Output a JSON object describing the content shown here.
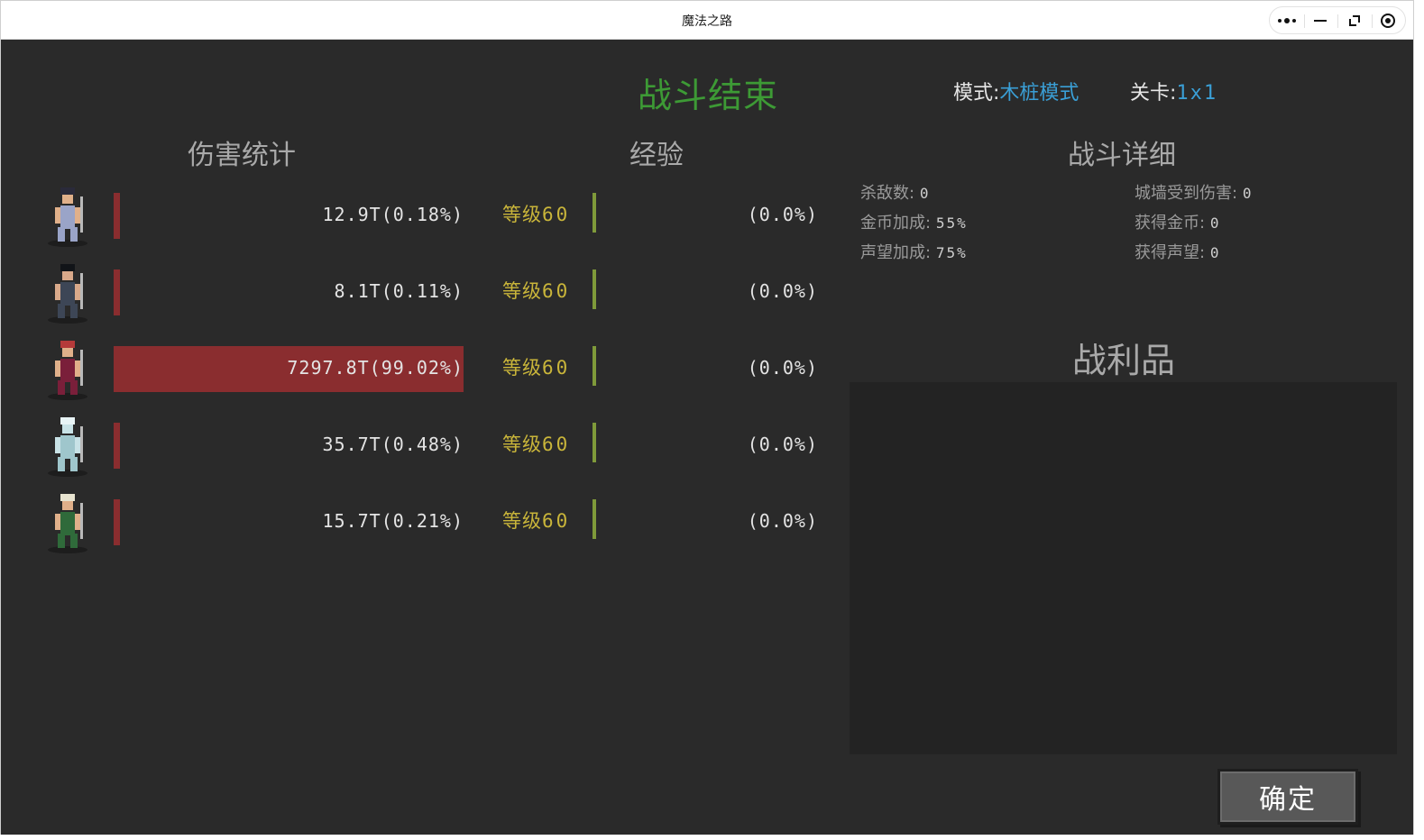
{
  "window": {
    "title": "魔法之路"
  },
  "titlebar": {
    "more_icon": "more-dots-icon",
    "minimize_icon": "minimize-icon",
    "restore_icon": "restore-icon",
    "record_icon": "target-icon"
  },
  "header": {
    "title": "战斗结束",
    "mode_label": "模式:",
    "mode_value": "木桩模式",
    "stage_label": "关卡:",
    "stage_value": "1x1"
  },
  "columns": {
    "damage": "伤害统计",
    "exp": "经验",
    "detail": "战斗详细"
  },
  "heroes": [
    {
      "damage": "12.9T(0.18%)",
      "damage_fraction": 0.0018,
      "level_label": "等级",
      "level": "60",
      "exp": "(0.0%)",
      "exp_fraction": 0.0,
      "colors": {
        "skin": "#e0b08a",
        "cloth": "#9aa4c8",
        "hair": "#2a2a3a"
      }
    },
    {
      "damage": "8.1T(0.11%)",
      "damage_fraction": 0.0011,
      "level_label": "等级",
      "level": "60",
      "exp": "(0.0%)",
      "exp_fraction": 0.0,
      "colors": {
        "skin": "#d9a98a",
        "cloth": "#3d4656",
        "hair": "#111418"
      }
    },
    {
      "damage": "7297.8T(99.02%)",
      "damage_fraction": 0.9902,
      "level_label": "等级",
      "level": "60",
      "exp": "(0.0%)",
      "exp_fraction": 0.0,
      "colors": {
        "skin": "#e0b08a",
        "cloth": "#7a1f3a",
        "hair": "#b53a3a"
      }
    },
    {
      "damage": "35.7T(0.48%)",
      "damage_fraction": 0.0048,
      "level_label": "等级",
      "level": "60",
      "exp": "(0.0%)",
      "exp_fraction": 0.0,
      "colors": {
        "skin": "#c8e2e6",
        "cloth": "#9fc6cc",
        "hair": "#e8f4f6"
      }
    },
    {
      "damage": "15.7T(0.21%)",
      "damage_fraction": 0.0021,
      "level_label": "等级",
      "level": "60",
      "exp": "(0.0%)",
      "exp_fraction": 0.0,
      "colors": {
        "skin": "#e0b08a",
        "cloth": "#2f6a3a",
        "hair": "#e8e4d0"
      }
    }
  ],
  "battle_detail": {
    "kills_label": "杀敌数:",
    "kills": "0",
    "wall_damage_label": "城墙受到伤害:",
    "wall_damage": "0",
    "gold_bonus_label": "金币加成:",
    "gold_bonus": "55%",
    "gold_gained_label": "获得金币:",
    "gold_gained": "0",
    "fame_bonus_label": "声望加成:",
    "fame_bonus": "75%",
    "fame_gained_label": "获得声望:",
    "fame_gained": "0"
  },
  "loot": {
    "title": "战利品"
  },
  "confirm_label": "确定",
  "theme": {
    "damage_bar": "#8a2d2f",
    "exp_bar": "#7f9a3a",
    "title_green": "#3d9a35",
    "accent_blue": "#3a9fd6",
    "level_yellow": "#c9b53a"
  }
}
